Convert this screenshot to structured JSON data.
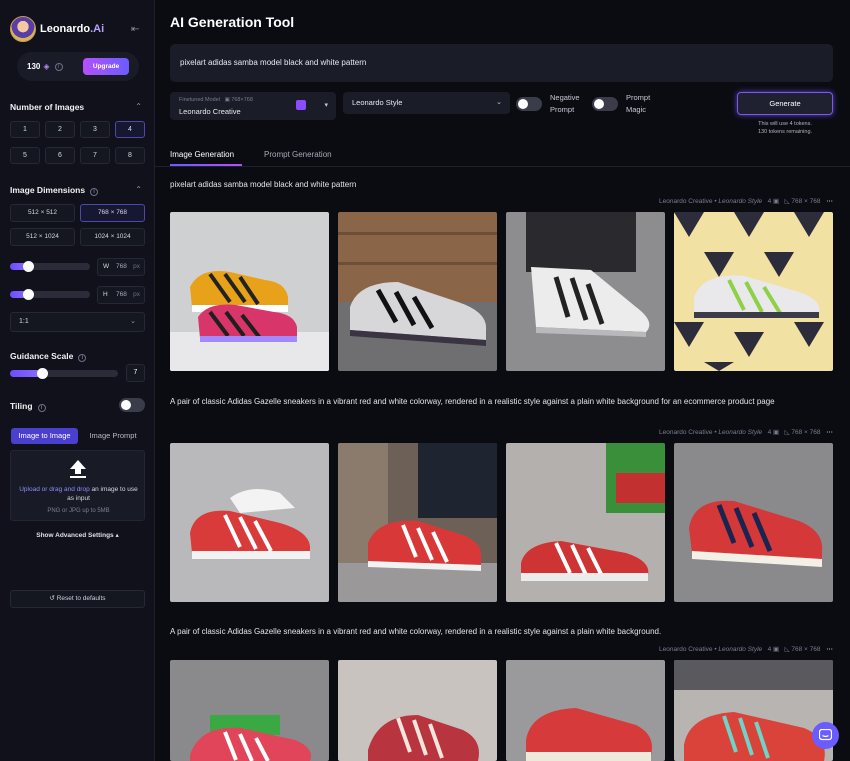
{
  "app": {
    "brand_name": "Leonardo",
    "brand_suffix": ".Ai"
  },
  "tokens": {
    "count": "130",
    "upgrade_label": "Upgrade"
  },
  "sidebar": {
    "num_images_title": "Number of Images",
    "num_images_options": [
      "1",
      "2",
      "3",
      "4",
      "5",
      "6",
      "7",
      "8"
    ],
    "num_images_selected": "4",
    "dimensions_title": "Image Dimensions",
    "dimension_options": [
      "512 × 512",
      "768 × 768",
      "512 × 1024",
      "1024 × 1024"
    ],
    "dimension_selected": "768 × 768",
    "width": {
      "label": "W",
      "value": "768",
      "unit": "px",
      "slider_fraction": 0.22
    },
    "height": {
      "label": "H",
      "value": "768",
      "unit": "px",
      "slider_fraction": 0.22
    },
    "aspect_ratio": "1:1",
    "guidance_title": "Guidance Scale",
    "guidance_value": "7",
    "guidance_fraction": 0.3,
    "tiling_label": "Tiling",
    "img2img_tab": "Image to Image",
    "imgprompt_tab": "Image Prompt",
    "upload_link": "Upload or drag and drop",
    "upload_rest": " an image to use as input",
    "upload_hint": "PNG or JPG up to 5MB",
    "advanced_label": "Show Advanced Settings",
    "reset_label": "Reset to defaults"
  },
  "main": {
    "title": "AI Generation Tool",
    "prompt": "pixelart adidas samba model black and white pattern",
    "model_caption": "Finetuned Model",
    "model_dims": "768×768",
    "model_name": "Leonardo Creative",
    "style_name": "Leonardo Style",
    "negative_prompt_l1": "Negative",
    "negative_prompt_l2": "Prompt",
    "prompt_magic_l1": "Prompt",
    "prompt_magic_l2": "Magic",
    "generate_label": "Generate",
    "gen_note_l1": "This will use 4 tokens.",
    "gen_note_l2": "130 tokens remaining.",
    "tabs": [
      "Image Generation",
      "Prompt Generation"
    ]
  },
  "generations": [
    {
      "prompt": "pixelart adidas samba model black and white pattern",
      "model": "Leonardo Creative",
      "style": "Leonardo Style",
      "count": "4",
      "dims": "768 × 768"
    },
    {
      "prompt": "A pair of classic Adidas Gazelle sneakers in a vibrant red and white colorway, rendered in a realistic style against a plain white background for an ecommerce product page",
      "model": "Leonardo Creative",
      "style": "Leonardo Style",
      "count": "4",
      "dims": "768 × 768"
    },
    {
      "prompt": "A pair of classic Adidas Gazelle sneakers in a vibrant red and white colorway, rendered in a realistic style against a plain white background.",
      "model": "Leonardo Creative",
      "style": "Leonardo Style",
      "count": "4",
      "dims": "768 × 768"
    }
  ],
  "colors": {
    "accent": "#6a5cff",
    "accent2": "#b450ff",
    "bg": "#0b0c12",
    "panel": "#1a1c28"
  }
}
